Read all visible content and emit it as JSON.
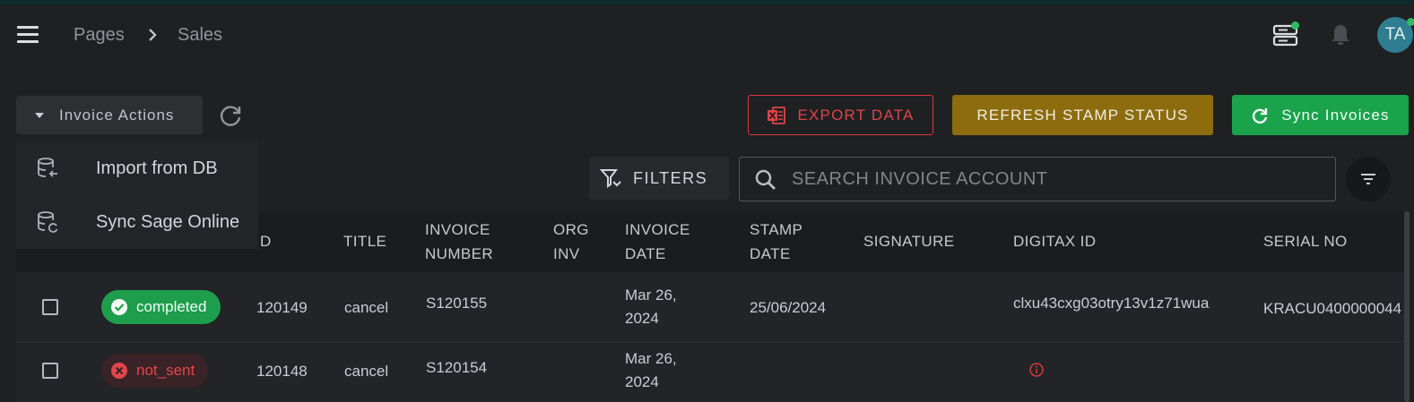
{
  "header": {
    "breadcrumbs": [
      "Pages",
      "Sales"
    ],
    "avatar_initials": "TA",
    "server_status_color": "#2ebd5f",
    "avatar_status_color": "#2ebd5f"
  },
  "toolbar": {
    "invoice_actions_label": "Invoice Actions",
    "export_label": "EXPORT DATA",
    "refresh_stamp_label": "REFRESH STAMP STATUS",
    "sync_label": "Sync Invoices",
    "colors": {
      "export": "#d9383c",
      "refresh_stamp": "#8c6c0d",
      "sync": "#1ba34c"
    }
  },
  "dropdown": {
    "items": [
      {
        "label": "Import from DB",
        "icon": "database-import-icon"
      },
      {
        "label": "Sync Sage Online",
        "icon": "database-sync-icon"
      }
    ]
  },
  "filters": {
    "filters_label": "FILTERS",
    "search_placeholder": "SEARCH INVOICE ACCOUNT",
    "search_value": ""
  },
  "table": {
    "headers": {
      "id": "D",
      "title": "TITLE",
      "invoice_number": [
        "INVOICE",
        "NUMBER"
      ],
      "org_inv": [
        "ORG",
        "INV"
      ],
      "invoice_date": [
        "INVOICE",
        "DATE"
      ],
      "stamp_date": [
        "STAMP",
        "DATE"
      ],
      "signature": "SIGNATURE",
      "digitax_id": "DIGITAX ID",
      "serial_no": "SERIAL NO"
    },
    "rows": [
      {
        "status": "completed",
        "id": "120149",
        "title": "cancel",
        "invoice_number": "S120155",
        "org_inv": "",
        "invoice_date": [
          "Mar 26,",
          "2024"
        ],
        "stamp_date": "25/06/2024",
        "signature": "",
        "digitax_id": "clxu43cxg03otry13v1z71wua",
        "serial_no": "KRACU0400000044"
      },
      {
        "status": "not_sent",
        "id": "120148",
        "title": "cancel",
        "invoice_number": "S120154",
        "org_inv": "",
        "invoice_date": [
          "Mar 26,",
          "2024"
        ],
        "stamp_date": "",
        "signature": "",
        "digitax_id_icon": "info-icon",
        "serial_no": ""
      }
    ]
  },
  "status_colors": {
    "completed": "#1e9e4c",
    "not_sent": "#e2464a"
  }
}
